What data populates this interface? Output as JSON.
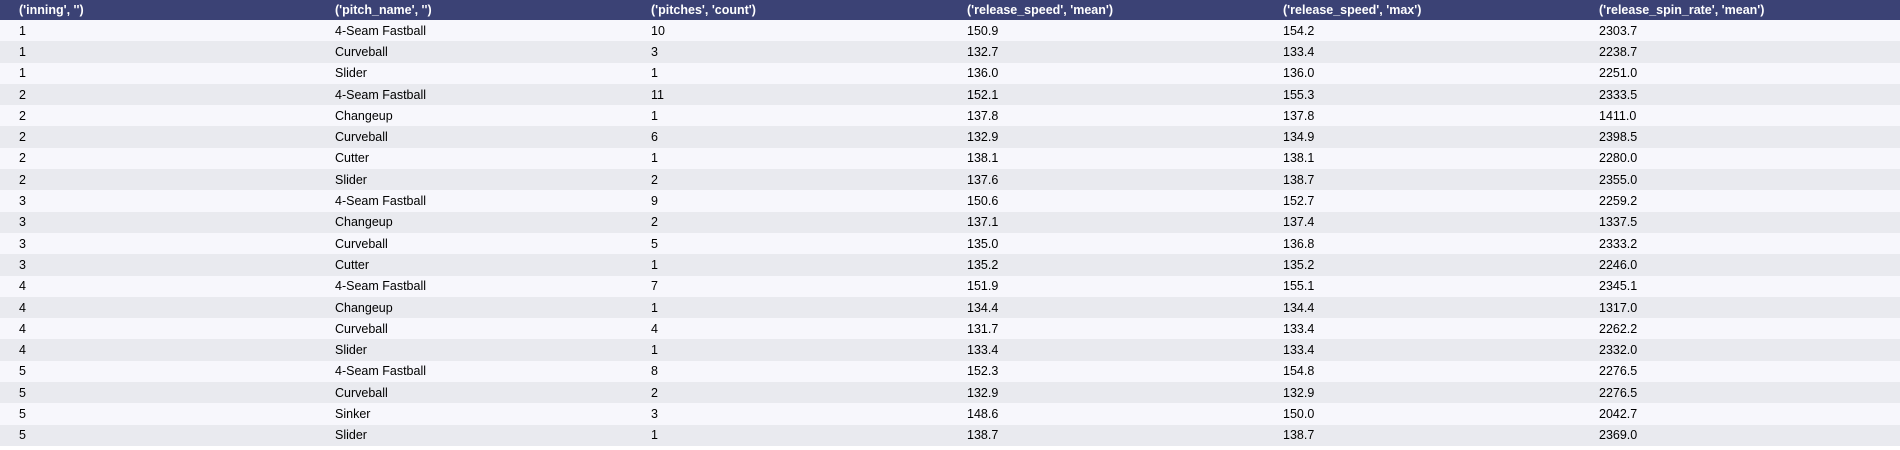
{
  "table": {
    "columns": [
      "('inning', '')",
      "('pitch_name', '')",
      "('pitches', 'count')",
      "('release_speed', 'mean')",
      "('release_speed', 'max')",
      "('release_spin_rate', 'mean')"
    ],
    "rows": [
      [
        "1",
        "4-Seam Fastball",
        "10",
        "150.9",
        "154.2",
        "2303.7"
      ],
      [
        "1",
        "Curveball",
        "3",
        "132.7",
        "133.4",
        "2238.7"
      ],
      [
        "1",
        "Slider",
        "1",
        "136.0",
        "136.0",
        "2251.0"
      ],
      [
        "2",
        "4-Seam Fastball",
        "11",
        "152.1",
        "155.3",
        "2333.5"
      ],
      [
        "2",
        "Changeup",
        "1",
        "137.8",
        "137.8",
        "1411.0"
      ],
      [
        "2",
        "Curveball",
        "6",
        "132.9",
        "134.9",
        "2398.5"
      ],
      [
        "2",
        "Cutter",
        "1",
        "138.1",
        "138.1",
        "2280.0"
      ],
      [
        "2",
        "Slider",
        "2",
        "137.6",
        "138.7",
        "2355.0"
      ],
      [
        "3",
        "4-Seam Fastball",
        "9",
        "150.6",
        "152.7",
        "2259.2"
      ],
      [
        "3",
        "Changeup",
        "2",
        "137.1",
        "137.4",
        "1337.5"
      ],
      [
        "3",
        "Curveball",
        "5",
        "135.0",
        "136.8",
        "2333.2"
      ],
      [
        "3",
        "Cutter",
        "1",
        "135.2",
        "135.2",
        "2246.0"
      ],
      [
        "4",
        "4-Seam Fastball",
        "7",
        "151.9",
        "155.1",
        "2345.1"
      ],
      [
        "4",
        "Changeup",
        "1",
        "134.4",
        "134.4",
        "1317.0"
      ],
      [
        "4",
        "Curveball",
        "4",
        "131.7",
        "133.4",
        "2262.2"
      ],
      [
        "4",
        "Slider",
        "1",
        "133.4",
        "133.4",
        "2332.0"
      ],
      [
        "5",
        "4-Seam Fastball",
        "8",
        "152.3",
        "154.8",
        "2276.5"
      ],
      [
        "5",
        "Curveball",
        "2",
        "132.9",
        "132.9",
        "2276.5"
      ],
      [
        "5",
        "Sinker",
        "3",
        "148.6",
        "150.0",
        "2042.7"
      ],
      [
        "5",
        "Slider",
        "1",
        "138.7",
        "138.7",
        "2369.0"
      ]
    ]
  },
  "colors": {
    "header_bg": "#3b4275",
    "row_odd": "#f7f7fc",
    "row_even": "#e9eaef"
  }
}
